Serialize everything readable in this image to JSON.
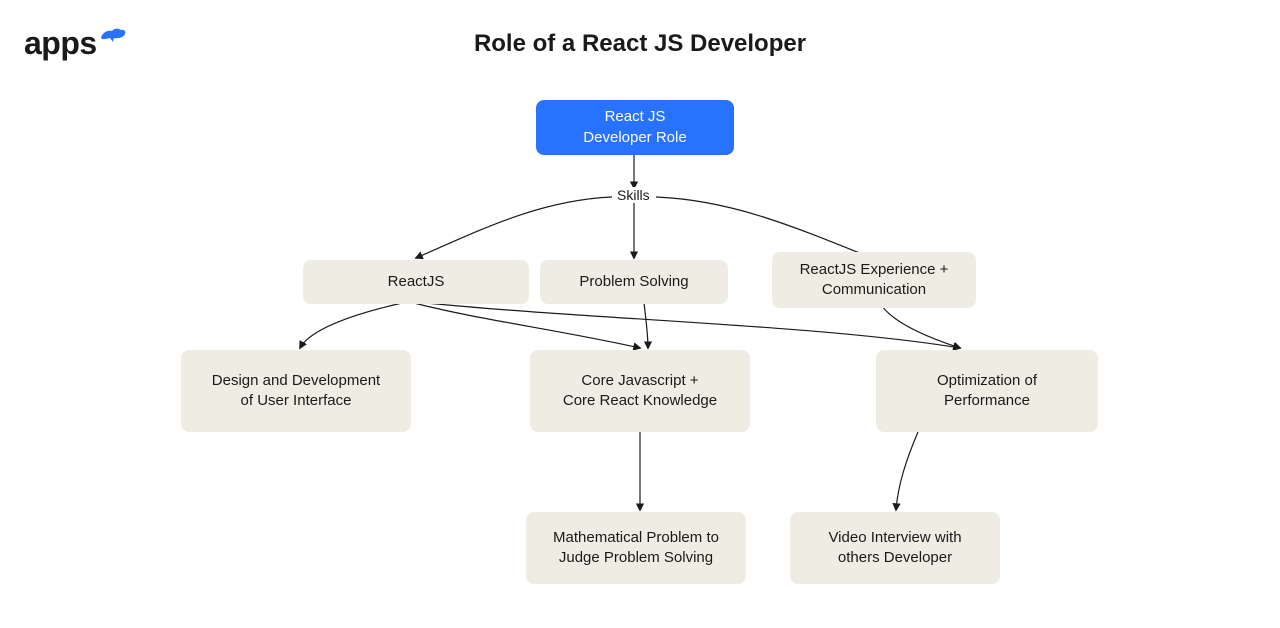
{
  "logo": {
    "text": "apps"
  },
  "title": "Role of a React JS Developer",
  "skills_label": "Skills",
  "nodes": {
    "root": {
      "line1": "React JS",
      "line2": "Developer Role"
    },
    "reactjs": "ReactJS",
    "problem_solving": "Problem Solving",
    "exp_comm": {
      "line1": "ReactJS Experience +",
      "line2": "Communication"
    },
    "design_ui": {
      "line1": "Design and Development",
      "line2": "of User Interface"
    },
    "core_js": {
      "line1": "Core Javascript +",
      "line2": "Core React Knowledge"
    },
    "opt_perf": {
      "line1": "Optimization of",
      "line2": "Performance"
    },
    "math_problem": {
      "line1": "Mathematical Problem to",
      "line2": "Judge Problem Solving"
    },
    "video_interview": {
      "line1": "Video Interview with",
      "line2": "others Developer"
    }
  },
  "colors": {
    "root_bg": "#2773ff",
    "box_bg": "#efece3",
    "text": "#1a1a1a",
    "arrow": "#1a1a1a"
  }
}
